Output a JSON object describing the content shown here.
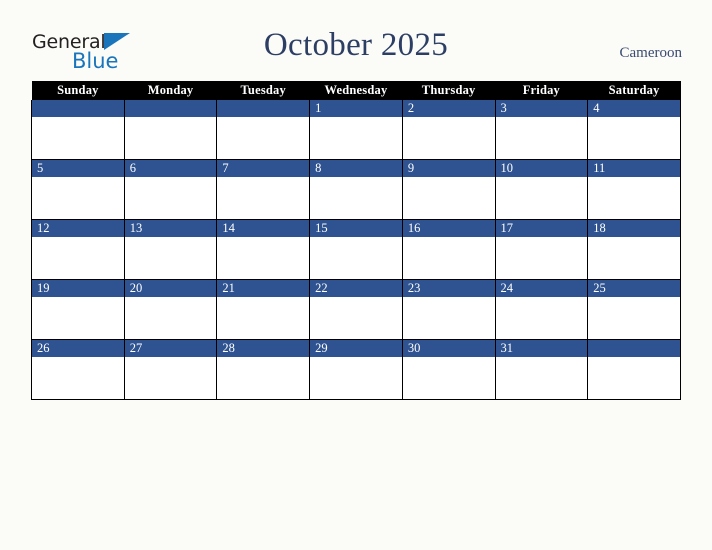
{
  "header": {
    "logo": {
      "word_primary": "General",
      "word_secondary": "Blue",
      "triangle_icon": "triangle-icon",
      "primary_color": "#231f20",
      "secondary_color": "#1b75bb"
    },
    "title": "October 2025",
    "country": "Cameroon",
    "title_color": "#2c3e63"
  },
  "calendar": {
    "month": "October",
    "year": "2025",
    "weekday_headers": [
      "Sunday",
      "Monday",
      "Tuesday",
      "Wednesday",
      "Thursday",
      "Friday",
      "Saturday"
    ],
    "header_background": "#000000",
    "header_text_color": "#ffffff",
    "daynum_background": "#2e5390",
    "daynum_text_color": "#ffffff",
    "cell_background": "#ffffff",
    "grid_line_color": "#000000",
    "weeks": [
      [
        "",
        "",
        "",
        "1",
        "2",
        "3",
        "4"
      ],
      [
        "5",
        "6",
        "7",
        "8",
        "9",
        "10",
        "11"
      ],
      [
        "12",
        "13",
        "14",
        "15",
        "16",
        "17",
        "18"
      ],
      [
        "19",
        "20",
        "21",
        "22",
        "23",
        "24",
        "25"
      ],
      [
        "26",
        "27",
        "28",
        "29",
        "30",
        "31",
        ""
      ]
    ]
  },
  "page": {
    "background_color": "#fbfbf8"
  }
}
